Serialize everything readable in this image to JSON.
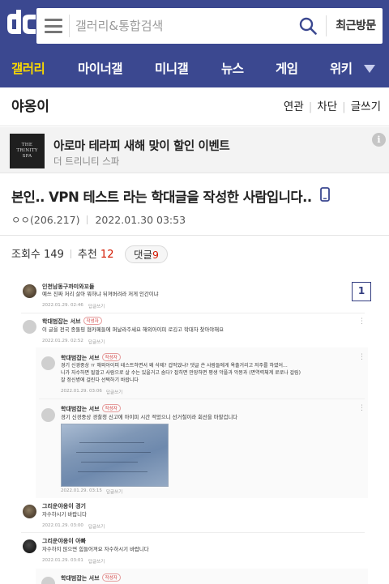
{
  "header": {
    "search_placeholder": "갤러리&통합검색",
    "recent_label": "최근방문"
  },
  "nav": {
    "items": [
      {
        "label": "갤러리"
      },
      {
        "label": "마이너갤"
      },
      {
        "label": "미니갤"
      },
      {
        "label": "뉴스"
      },
      {
        "label": "게임"
      },
      {
        "label": "위키"
      }
    ]
  },
  "gallery": {
    "name": "야옹이",
    "links": [
      "연관",
      "차단",
      "글쓰기"
    ]
  },
  "ad": {
    "logo_text": [
      "THE",
      "TRINITY",
      "SPA"
    ],
    "title": "아로마 테라피 새해 맞이 할인 이벤트",
    "subtitle": "더 트리니티 스파"
  },
  "post": {
    "title": "본인.. VPN 테스트 라는 학대글을 작성한 사람입니다..",
    "author": "ㅇㅇ(206.217)",
    "date": "2022.01.30 03:53",
    "views_label": "조회수",
    "views": "149",
    "recommend_label": "추천",
    "recommend": "12",
    "comments_label": "댓글",
    "comments": "9"
  },
  "screenshot": {
    "page_number": "1",
    "reply_label": "답글쓰기",
    "comments": [
      {
        "name": "인천남동구까미와꼬들",
        "text": [
          "예쓰 진짜 저리 살아 뭐하냐 뒤져버려라 저게 인간이냐"
        ],
        "date": "2022.01.29. 02:46"
      },
      {
        "name": "학대범잡는 서브",
        "tag": "작성자",
        "text": [
          "이 글을 전국 종돌핑 협카페들에 퍼날라주세요 해외아이피 로깅고 학대자 찾아야해요"
        ],
        "date": "2022.01.29. 02:52"
      },
      {
        "name": "학대범잡는 서브",
        "tag": "작성자",
        "text": [
          "경기 신경중상 ㅠ 해외아이피 테스트하면서 왜 삭제? 겁먹었냐? 댓글 쓴 사람들에게 욕출거리고 저주를 하였어...",
          "니가 자수하면 될말고 사람으로 살 수는 있을거고 숨다? 잡히면 만장하면 평생 악플과 악몽과 (면역력체계 로로나 걸림)",
          "잘 정신병에 걸린다 선택하기 바랍니다"
        ],
        "date": "2022.01.29. 03:06"
      },
      {
        "name": "학대범잡는 서브",
        "tag": "작성자",
        "text": [
          "경기 신경중상 경찰청 신고에 아이피 시간 적었으니 선거철이라 회선을 마할겁니다"
        ],
        "date": "2022.01.29. 03:15"
      },
      {
        "name": "그리운야옹이 경기",
        "text": [
          "자수하시기 바랍니다"
        ],
        "date": "2022.01.29. 03:00"
      },
      {
        "name": "그리운야옹이 아빠",
        "text": [
          "자수하지 않으면 힘들어져요 자수하시기 바랍니다"
        ],
        "date": "2022.01.29. 03:01"
      },
      {
        "name": "학대범잡는 서브",
        "tag": "작성자",
        "text": [],
        "date": ""
      }
    ]
  }
}
